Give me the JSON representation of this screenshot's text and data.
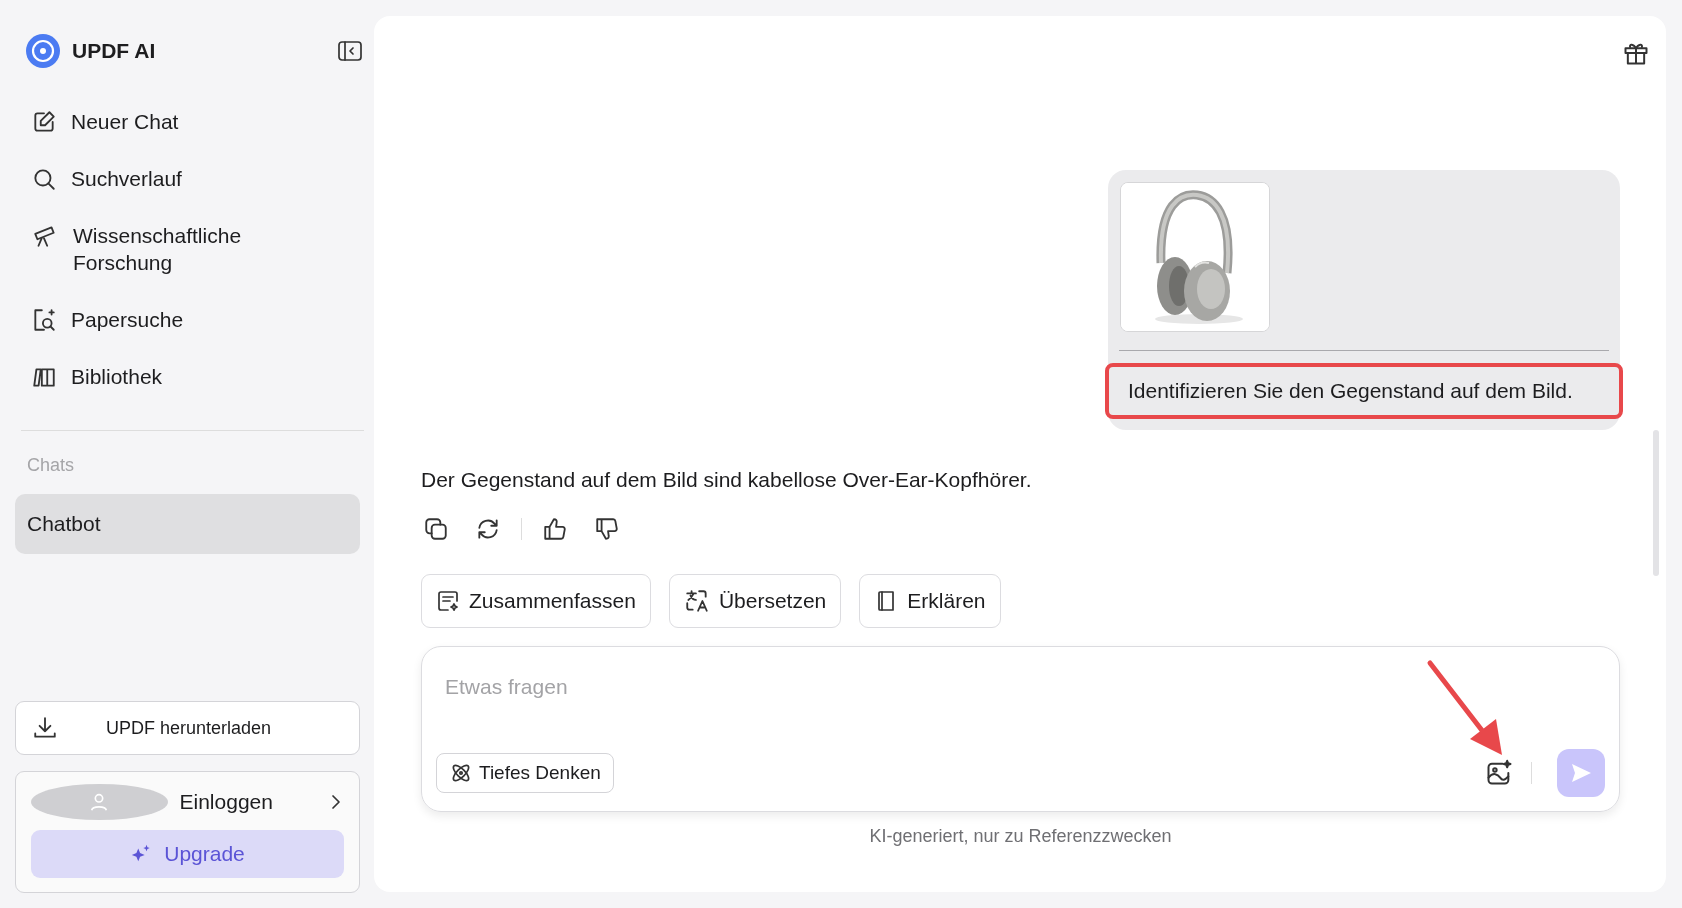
{
  "sidebar": {
    "app_name": "UPDF AI",
    "nav_items": [
      {
        "label": "Neuer Chat",
        "kind": "new-chat"
      },
      {
        "label": "Suchverlauf",
        "kind": "search"
      },
      {
        "label": "Wissenschaftliche Forschung",
        "kind": "research"
      },
      {
        "label": "Papersuche",
        "kind": "paper-search"
      },
      {
        "label": "Bibliothek",
        "kind": "library"
      }
    ],
    "section_label": "Chats",
    "chats": [
      {
        "label": "Chatbot",
        "selected": true
      }
    ],
    "download_button": "UPDF herunterladen",
    "login": "Einloggen",
    "upgrade_button": "Upgrade"
  },
  "conversation": {
    "user_message": {
      "text": "Identifizieren Sie den Gegenstand auf dem Bild.",
      "highlighted": true
    },
    "reply": "Der Gegenstand auf dem Bild sind kabellose Over-Ear-Kopfhörer."
  },
  "quick_actions": [
    {
      "label": "Zusammenfassen",
      "kind": "summarize"
    },
    {
      "label": "Übersetzen",
      "kind": "translate"
    },
    {
      "label": "Erklären",
      "kind": "explain"
    }
  ],
  "composer": {
    "placeholder": "Etwas fragen",
    "deep_think_button": "Tiefes Denken"
  },
  "disclaimer": "KI-generiert, nur zu Referenzzwecken"
}
